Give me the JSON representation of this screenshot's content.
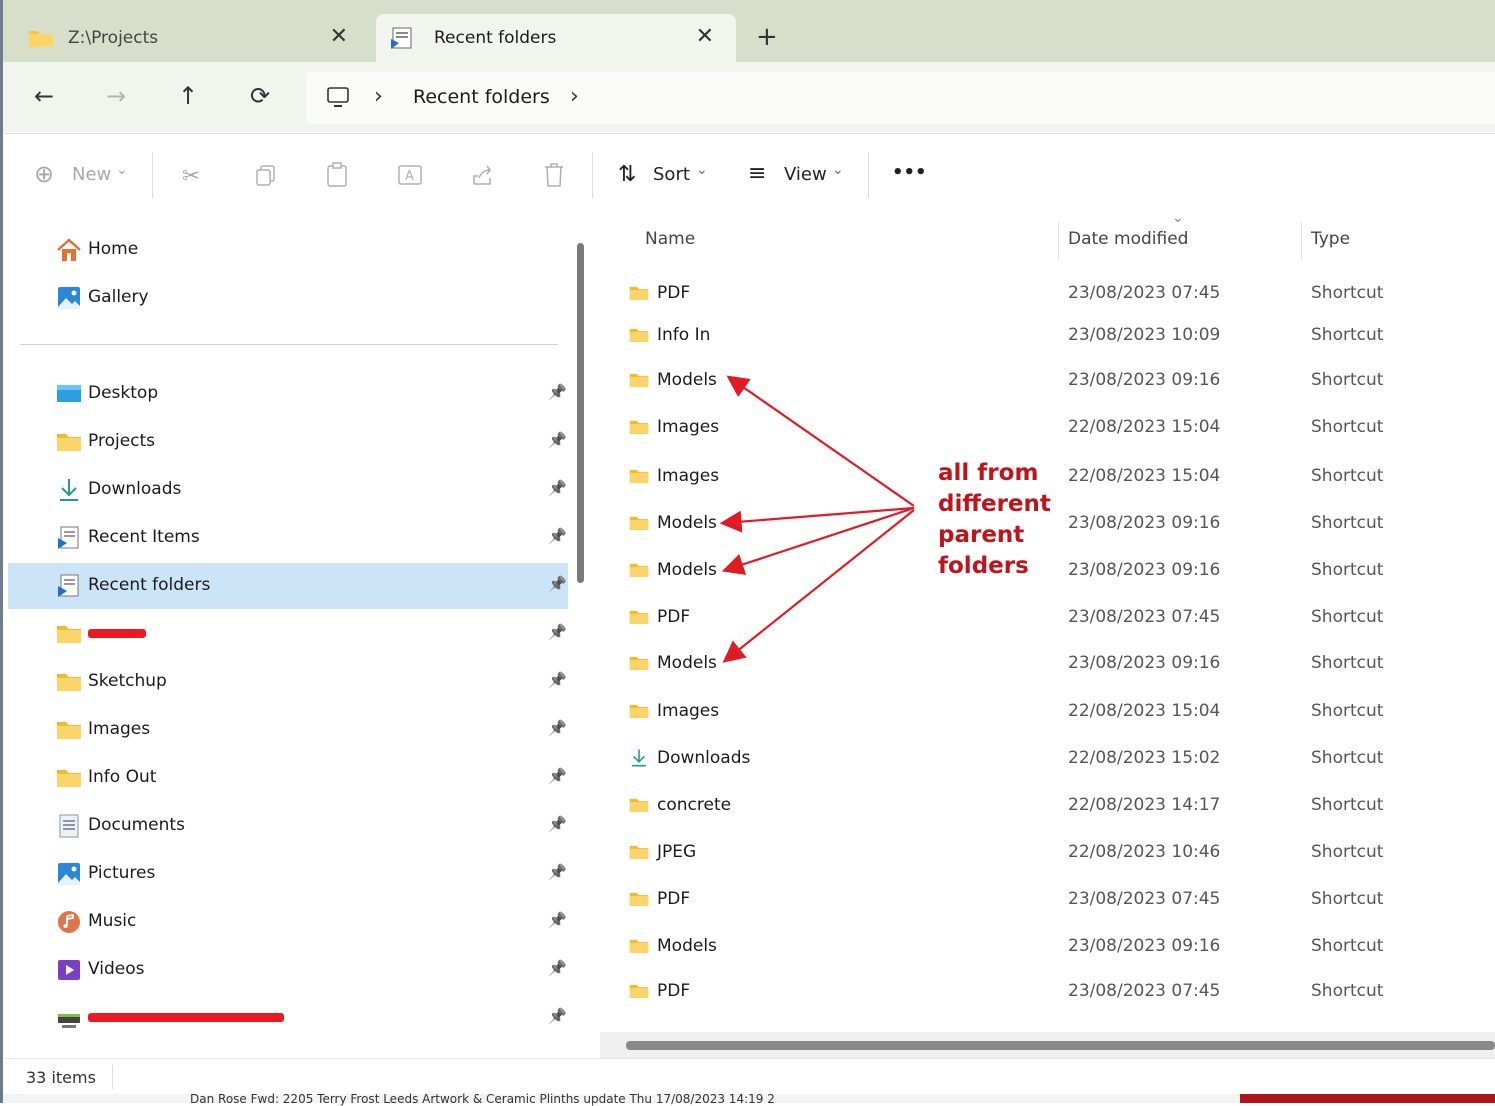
{
  "tabs": [
    {
      "label": "Z:\\Projects",
      "close": "✕",
      "icon": "folder-icon"
    },
    {
      "label": "Recent folders",
      "close": "✕",
      "icon": "recent-folders-icon"
    }
  ],
  "new_tab_label": "+",
  "address": {
    "back": "←",
    "forward": "→",
    "up": "↑",
    "refresh": "⟳",
    "breadcrumb": [
      "Recent folders"
    ],
    "chevron": "›"
  },
  "toolbar": {
    "new_label": "New",
    "sort_label": "Sort",
    "view_label": "View",
    "more_label": "•••",
    "caret": "⌄"
  },
  "nav": {
    "quick": [
      {
        "label": "Home",
        "icon": "home-icon"
      },
      {
        "label": "Gallery",
        "icon": "gallery-icon"
      }
    ],
    "pinned": [
      {
        "label": "Desktop",
        "icon": "desktop-icon"
      },
      {
        "label": "Projects",
        "icon": "folder-icon"
      },
      {
        "label": "Downloads",
        "icon": "download-icon"
      },
      {
        "label": "Recent Items",
        "icon": "recent-items-icon"
      },
      {
        "label": "Recent folders",
        "icon": "recent-folders-icon",
        "selected": true
      },
      {
        "label": "",
        "icon": "folder-icon",
        "redacted": true
      },
      {
        "label": "Sketchup",
        "icon": "folder-icon"
      },
      {
        "label": "Images",
        "icon": "folder-icon"
      },
      {
        "label": "Info Out",
        "icon": "folder-icon"
      },
      {
        "label": "Documents",
        "icon": "documents-icon"
      },
      {
        "label": "Pictures",
        "icon": "pictures-icon"
      },
      {
        "label": "Music",
        "icon": "music-icon"
      },
      {
        "label": "Videos",
        "icon": "videos-icon"
      },
      {
        "label": "",
        "icon": "network-drive-icon",
        "redacted": true
      }
    ],
    "pin_glyph": "📌"
  },
  "columns": {
    "name": "Name",
    "date": "Date modified",
    "type": "Type"
  },
  "files": [
    {
      "name": "PDF",
      "date": "23/08/2023 07:45",
      "type": "Shortcut",
      "icon": "folder-icon"
    },
    {
      "name": "Info In",
      "date": "23/08/2023 10:09",
      "type": "Shortcut",
      "icon": "folder-icon"
    },
    {
      "name": "Models",
      "date": "23/08/2023 09:16",
      "type": "Shortcut",
      "icon": "folder-icon"
    },
    {
      "name": "Images",
      "date": "22/08/2023 15:04",
      "type": "Shortcut",
      "icon": "folder-icon"
    },
    {
      "name": "Images",
      "date": "22/08/2023 15:04",
      "type": "Shortcut",
      "icon": "folder-icon"
    },
    {
      "name": "Models",
      "date": "23/08/2023 09:16",
      "type": "Shortcut",
      "icon": "folder-icon"
    },
    {
      "name": "Models",
      "date": "23/08/2023 09:16",
      "type": "Shortcut",
      "icon": "folder-icon"
    },
    {
      "name": "PDF",
      "date": "23/08/2023 07:45",
      "type": "Shortcut",
      "icon": "folder-icon"
    },
    {
      "name": "Models",
      "date": "23/08/2023 09:16",
      "type": "Shortcut",
      "icon": "folder-icon"
    },
    {
      "name": "Images",
      "date": "22/08/2023 15:04",
      "type": "Shortcut",
      "icon": "folder-icon"
    },
    {
      "name": "Downloads",
      "date": "22/08/2023 15:02",
      "type": "Shortcut",
      "icon": "download-icon"
    },
    {
      "name": "concrete",
      "date": "22/08/2023 14:17",
      "type": "Shortcut",
      "icon": "folder-icon"
    },
    {
      "name": "JPEG",
      "date": "22/08/2023 10:46",
      "type": "Shortcut",
      "icon": "folder-icon"
    },
    {
      "name": "PDF",
      "date": "23/08/2023 07:45",
      "type": "Shortcut",
      "icon": "folder-icon"
    },
    {
      "name": "Models",
      "date": "23/08/2023 09:16",
      "type": "Shortcut",
      "icon": "folder-icon"
    },
    {
      "name": "PDF",
      "date": "23/08/2023 07:45",
      "type": "Shortcut",
      "icon": "folder-icon"
    }
  ],
  "annotation": {
    "lines": [
      "all from",
      "different",
      "parent",
      "folders"
    ],
    "color": "#c0131a"
  },
  "status": {
    "item_count": "33 items"
  },
  "background_strip": "Dan Rose          Fwd: 2205 Terry Frost Leeds Artwork & Ceramic Plinths update      Thu 17/08/2023 14:19       2",
  "colors": {
    "folder": "#f6c343",
    "accent": "#0067c0",
    "selected": "#cce4f7",
    "titlebar": "#d7dfcb",
    "annotation": "#e01b24"
  }
}
